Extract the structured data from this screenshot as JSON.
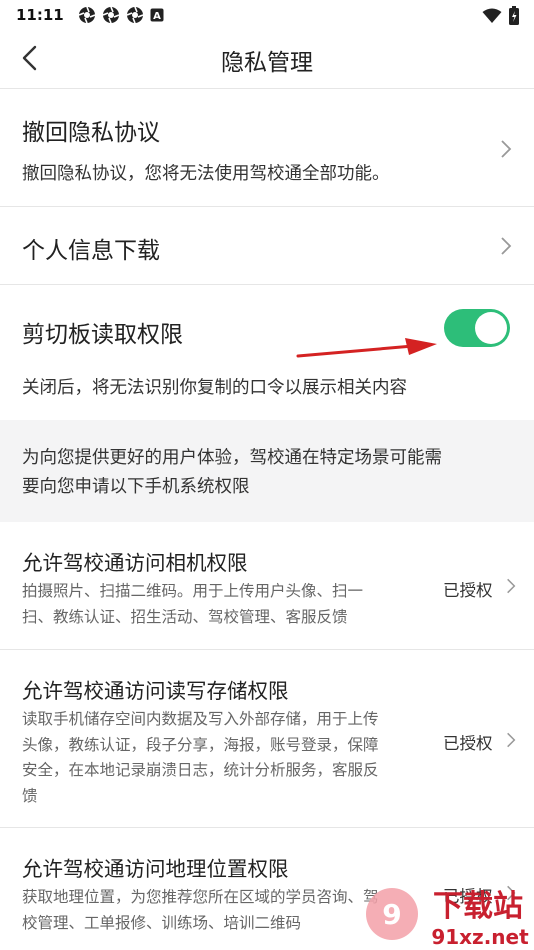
{
  "status_bar": {
    "time": "11:11",
    "icons": [
      "notification-app-icon",
      "notification-app-icon",
      "notification-app-icon",
      "keyboard-a-icon"
    ],
    "right_icons": [
      "wifi-icon",
      "battery-icon"
    ]
  },
  "header": {
    "title": "隐私管理"
  },
  "revoke": {
    "title": "撤回隐私协议",
    "desc": "撤回隐私协议，您将无法使用驾校通全部功能。"
  },
  "download": {
    "title": "个人信息下载"
  },
  "clipboard": {
    "title": "剪切板读取权限",
    "desc": "关闭后，将无法识别你复制的口令以展示相关内容",
    "enabled": true
  },
  "notice": {
    "line1": "为向您提供更好的用户体验，驾校通在特定场景可能需",
    "line2": "要向您申请以下手机系统权限"
  },
  "permissions": [
    {
      "title": "允许驾校通访问相机权限",
      "desc_lines": [
        "拍摄照片、扫描二维码。用于上传用户头像、扫一",
        "扫、教练认证、招生活动、驾校管理、客服反馈"
      ],
      "status": "已授权"
    },
    {
      "title": "允许驾校通访问读写存储权限",
      "desc_lines": [
        "读取手机储存空间内数据及写入外部存储，用于上传",
        "头像，教练认证，段子分享，海报，账号登录，保障",
        "安全，在本地记录崩溃日志，统计分析服务，客服反",
        "馈"
      ],
      "status": "已授权"
    },
    {
      "title": "允许驾校通访问地理位置权限",
      "desc_lines": [
        "获取地理位置，为您推荐您所在区域的学员咨询、驾",
        "校管理、工单报修、训练场、培训二维码"
      ],
      "status": "已授权"
    }
  ],
  "watermark": {
    "text_cn": "下载站",
    "text_url": "91xz.net"
  },
  "colors": {
    "toggle_on": "#2dbe79",
    "arrow": "#d42222",
    "notice_bg": "#f4f4f5"
  }
}
